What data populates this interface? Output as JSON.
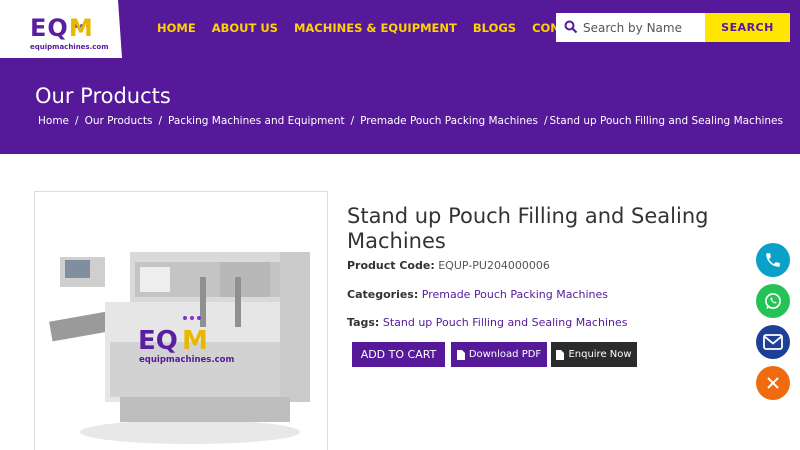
{
  "logo": {
    "letters": [
      "E",
      "Q",
      "M"
    ],
    "domain": "equipmachines.com"
  },
  "nav": {
    "items": [
      "HOME",
      "ABOUT US",
      "MACHINES & EQUIPMENT",
      "BLOGS",
      "CONTACT"
    ]
  },
  "search": {
    "placeholder": "Search by Name",
    "button": "SEARCH"
  },
  "hero": {
    "title": "Our Products",
    "breadcrumb": [
      "Home",
      "Our Products",
      "Packing Machines and Equipment",
      "Premade Pouch Packing Machines",
      "Stand up Pouch Filling and Sealing Machines"
    ]
  },
  "product": {
    "title": "Stand up Pouch Filling and Sealing Machines",
    "code_label": "Product Code:",
    "code": "EQUP-PU204000006",
    "categories_label": "Categories:",
    "category": "Premade Pouch Packing Machines",
    "tags_label": "Tags:",
    "tag": "Stand up Pouch Filling and Sealing Machines",
    "image_watermark": "equipmachines.com"
  },
  "buttons": {
    "cart": "ADD TO CART",
    "pdf": "Download PDF",
    "enquire": "Enquire Now"
  },
  "floating": [
    "phone-icon",
    "whatsapp-icon",
    "mail-icon",
    "close-icon"
  ],
  "colors": {
    "brand_purple": "#55199a",
    "accent_yellow": "#ffe600",
    "nav_text": "#ffd200"
  }
}
